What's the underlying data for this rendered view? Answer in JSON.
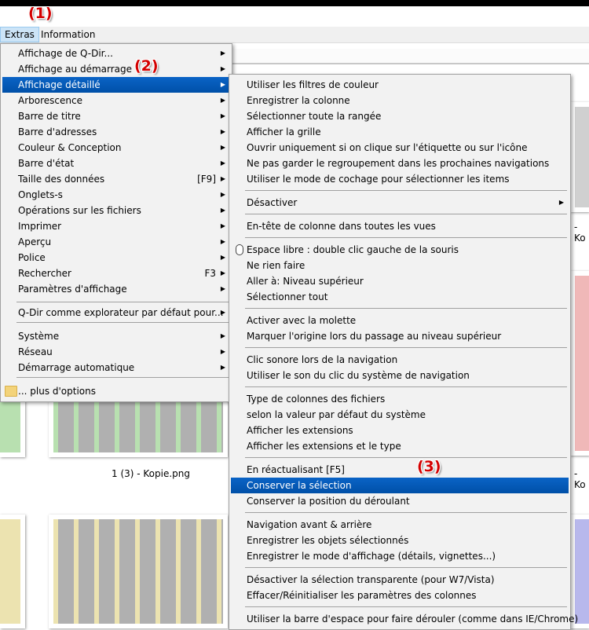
{
  "annotations": [
    "(1)",
    "(2)",
    "(3)"
  ],
  "menubar": {
    "extras": "Extras",
    "information": "Information"
  },
  "captions": {
    "c1": "1 (3) - Kopie.png",
    "c2": "- Ko",
    "c3": "- Ko"
  },
  "menu1": {
    "items": [
      {
        "label": "Affichage de Q-Dir...",
        "submenu": true
      },
      {
        "label": "Affichage au démarrage",
        "submenu": true
      },
      {
        "label": "Affichage détaillé",
        "submenu": true,
        "highlight": true
      },
      {
        "label": "Arborescence",
        "submenu": true
      },
      {
        "label": "Barre de titre",
        "submenu": true
      },
      {
        "label": "Barre d'adresses",
        "submenu": true
      },
      {
        "label": "Couleur & Conception",
        "submenu": true
      },
      {
        "label": "Barre d'état",
        "submenu": true
      },
      {
        "label": "Taille des données",
        "shortcut": "[F9]",
        "submenu": true
      },
      {
        "label": "Onglets-s",
        "submenu": true
      },
      {
        "label": "Opérations sur les fichiers",
        "submenu": true
      },
      {
        "label": "Imprimer",
        "submenu": true
      },
      {
        "label": "Aperçu",
        "submenu": true
      },
      {
        "label": "Police",
        "submenu": true
      },
      {
        "label": "Rechercher",
        "shortcut": "F3",
        "submenu": true
      },
      {
        "label": "Paramètres d'affichage",
        "submenu": true
      },
      {
        "label": "Q-Dir comme explorateur par défaut pour...",
        "submenu": true
      },
      {
        "label": "Système",
        "submenu": true
      },
      {
        "label": "Réseau",
        "submenu": true
      },
      {
        "label": "Démarrage automatique",
        "submenu": true
      },
      {
        "label": "... plus d'options",
        "icon": "folder-icon"
      }
    ]
  },
  "menu2": {
    "items": [
      {
        "label": "Utiliser les filtres de couleur"
      },
      {
        "label": "Enregistrer la colonne"
      },
      {
        "label": "Sélectionner toute la rangée"
      },
      {
        "label": "Afficher la grille"
      },
      {
        "label": "Ouvrir uniquement si on clique sur l'étiquette ou sur l'icône"
      },
      {
        "label": "Ne pas garder le regroupement dans les prochaines navigations"
      },
      {
        "label": "Utiliser le mode de cochage pour sélectionner les items"
      },
      {
        "label": "Désactiver",
        "submenu": true
      },
      {
        "label": "En-tête de colonne dans toutes les vues"
      },
      {
        "label": "Espace libre : double clic gauche de la souris",
        "icon": "mouse-icon"
      },
      {
        "label": "Ne rien faire"
      },
      {
        "label": "Aller à: Niveau supérieur"
      },
      {
        "label": "Sélectionner tout"
      },
      {
        "label": "Activer avec la molette"
      },
      {
        "label": "Marquer l'origine lors du passage au niveau supérieur"
      },
      {
        "label": "Clic sonore lors de la navigation"
      },
      {
        "label": "Utiliser le son du clic du système de navigation"
      },
      {
        "label": "Type de colonnes des fichiers"
      },
      {
        "label": "selon la valeur par défaut du système"
      },
      {
        "label": "Afficher les extensions"
      },
      {
        "label": "Afficher les extensions et le type"
      },
      {
        "label": "En réactualisant [F5]"
      },
      {
        "label": "Conserver la sélection",
        "highlight": true
      },
      {
        "label": "Conserver la position du déroulant"
      },
      {
        "label": "Navigation avant & arrière"
      },
      {
        "label": "Enregistrer les objets sélectionnés"
      },
      {
        "label": "Enregistrer le mode d'affichage (détails, vignettes...)"
      },
      {
        "label": "Désactiver la sélection transparente (pour W7/Vista)"
      },
      {
        "label": "Effacer/Réinitialiser les paramètres des colonnes"
      },
      {
        "label": "Utiliser la barre d'espace pour faire dérouler (comme dans IE/Chrome)"
      }
    ]
  },
  "colors": {
    "highlight": "#0a5cb8",
    "annotation": "#d40000",
    "green": "#b8e0b0",
    "red": "#f0b8b8",
    "yellow": "#ece3b0",
    "blue": "#b8b8ec"
  }
}
